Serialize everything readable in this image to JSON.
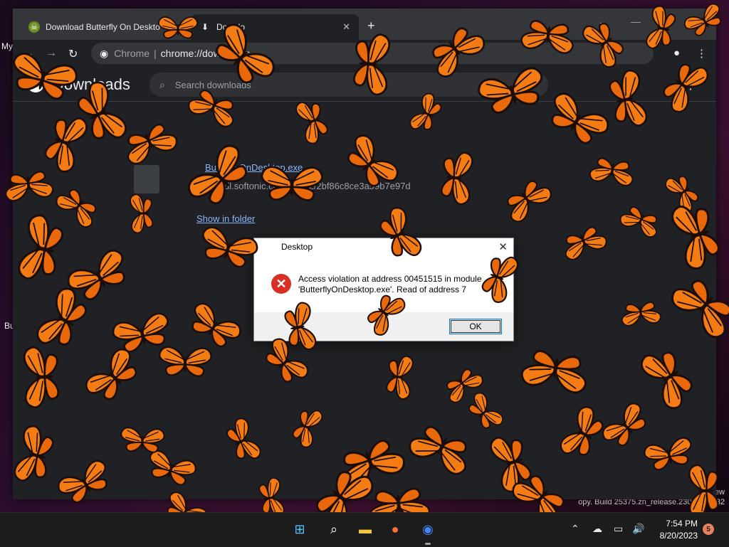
{
  "desktop": {
    "label_my": "My",
    "label_bu": "Bu",
    "build_text": "ew",
    "watermark_text": "opy. Build 25375.zn_release.230512-1632"
  },
  "browser": {
    "tabs": [
      {
        "label": "Download Butterfly On Deskto",
        "icon": "pirate-favicon-icon",
        "active": false
      },
      {
        "label": "Downlo",
        "icon": "download-icon",
        "active": true
      }
    ],
    "new_tab": "+",
    "omnibox": {
      "chip": "Chrome",
      "url": "chrome://downloads"
    },
    "page_title": "Downloads",
    "search_placeholder": "Search downloads",
    "download": {
      "filename": "ButterflyOnDesktop.exe",
      "url": "https://dl.softonic.com/soft32/2bf86c8ce3a59b7e97d",
      "show_link": "Show in folder"
    }
  },
  "dialog": {
    "title": "Desktop",
    "message_line1": "Access violation at address 00451515 in module",
    "message_line2": "'ButterflyOnDesktop.exe'. Read of address 7",
    "ok_label": "OK"
  },
  "taskbar": {
    "time": "7:54 PM",
    "date": "8/20/2023",
    "notification_count": "5"
  },
  "colors": {
    "butterfly_orange": "#f57c12",
    "butterfly_dark": "#1a0d05",
    "error_red": "#d93025",
    "chrome_dark": "#202124"
  }
}
